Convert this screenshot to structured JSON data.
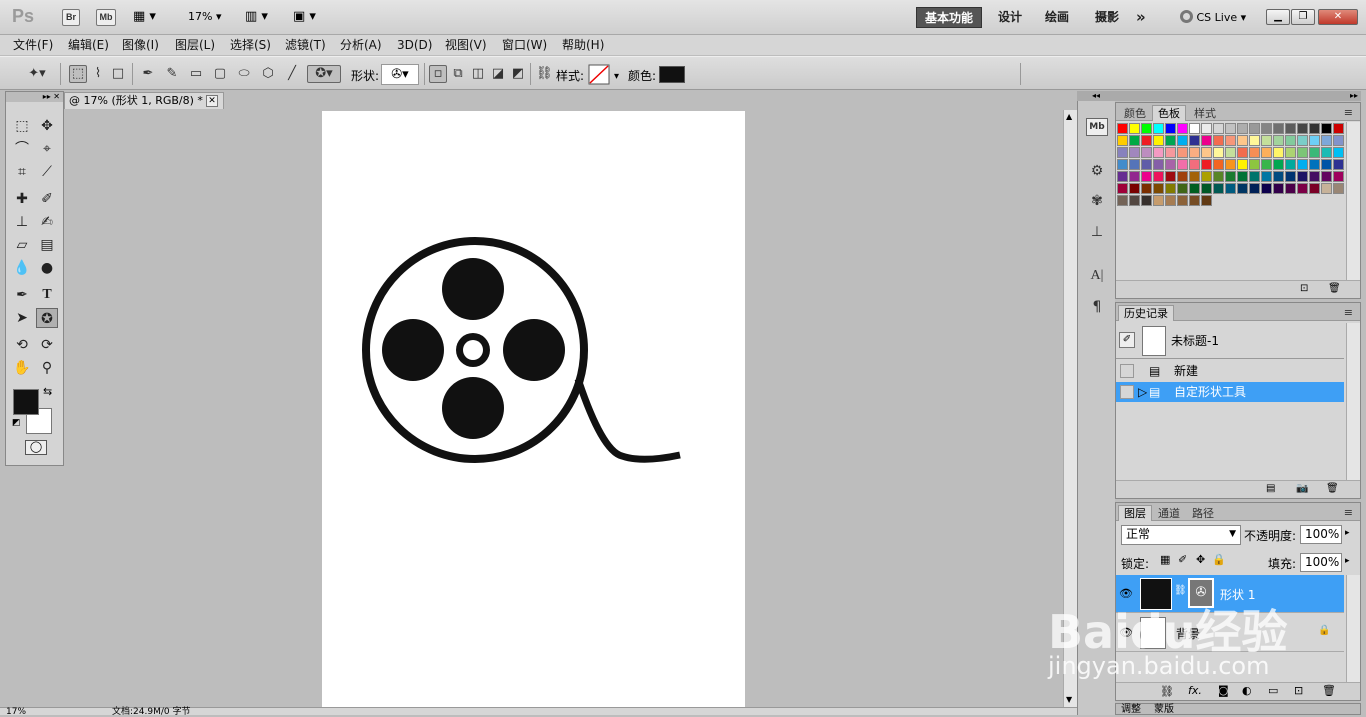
{
  "app": {
    "logo": "Ps",
    "bridge_btn": "Br",
    "minibridge_btn": "Mb",
    "zoom": "17%",
    "workspaces": [
      "基本功能",
      "设计",
      "绘画",
      "摄影"
    ],
    "more": "»",
    "cslive": "CS Live"
  },
  "menu": [
    "文件(F)",
    "编辑(E)",
    "图像(I)",
    "图层(L)",
    "选择(S)",
    "滤镜(T)",
    "分析(A)",
    "3D(D)",
    "视图(V)",
    "窗口(W)",
    "帮助(H)"
  ],
  "options": {
    "shape_label": "形状:",
    "style_label": "样式:",
    "color_label": "颜色:",
    "color": "#111111"
  },
  "document": {
    "tab_title": "@ 17% (形状 1, RGB/8) *",
    "status": "文档:24.9M/0 字节",
    "zoom": "17%"
  },
  "panels": {
    "swatches": {
      "tabs": [
        "颜色",
        "色板",
        "样式"
      ],
      "active": 1,
      "colors": [
        "#ff0000",
        "#ffff00",
        "#00ff00",
        "#00ffff",
        "#0000ff",
        "#ff00ff",
        "#ffffff",
        "#ebebeb",
        "#d6d6d6",
        "#c2c2c2",
        "#adadad",
        "#999999",
        "#858585",
        "#707070",
        "#5c5c5c",
        "#474747",
        "#333333",
        "#000000",
        "#cc0000",
        "#ffcc00",
        "#00aa44",
        "#ee1c24",
        "#fff200",
        "#00a651",
        "#00aeef",
        "#2e3192",
        "#ec008c",
        "#f26c4f",
        "#f69679",
        "#fdc68a",
        "#fff799",
        "#c4df9b",
        "#a2d39c",
        "#82ca9c",
        "#7bcdc8",
        "#6dcff6",
        "#7da7d9",
        "#8393ca",
        "#8781bd",
        "#a187be",
        "#bc8dbf",
        "#f49ac2",
        "#f6989d",
        "#f7977a",
        "#f9ad81",
        "#fdc68a",
        "#fff79a",
        "#c4df9b",
        "#f26c4f",
        "#f68e55",
        "#fbaf5c",
        "#fff467",
        "#acd372",
        "#7cc576",
        "#3bb878",
        "#1abbb4",
        "#00bff3",
        "#438ccb",
        "#5574b9",
        "#605ca8",
        "#855fa8",
        "#a763a8",
        "#f06ea9",
        "#f26d7d",
        "#ed1c24",
        "#f26522",
        "#f7941d",
        "#fff200",
        "#8dc63f",
        "#39b54a",
        "#00a651",
        "#00a99d",
        "#00aeef",
        "#0072bc",
        "#0054a6",
        "#2e3192",
        "#662d91",
        "#92278f",
        "#ec008c",
        "#ed145b",
        "#9e0b0f",
        "#a0410d",
        "#a36209",
        "#aba000",
        "#598527",
        "#1a7b30",
        "#007236",
        "#00746b",
        "#0076a3",
        "#004b80",
        "#003471",
        "#1b1464",
        "#440e62",
        "#630460",
        "#9e005d",
        "#9e0039",
        "#790000",
        "#7b2e00",
        "#7d4900",
        "#827b00",
        "#406618",
        "#005e20",
        "#005826",
        "#005952",
        "#005b7f",
        "#003663",
        "#002157",
        "#0d004c",
        "#32004b",
        "#4b0049",
        "#7b0046",
        "#7a0026",
        "#c7b299",
        "#998675",
        "#736357",
        "#534741",
        "#37302d",
        "#c69c6d",
        "#a67c52",
        "#8c6239",
        "#754c24",
        "#603913"
      ]
    },
    "history": {
      "title": "历史记录",
      "snapshot": "未标题-1",
      "items": [
        "新建",
        "自定形状工具"
      ]
    },
    "layers": {
      "tabs": [
        "图层",
        "通道",
        "路径"
      ],
      "blend_mode": "正常",
      "opacity_label": "不透明度:",
      "opacity": "100%",
      "lock_label": "锁定:",
      "fill_label": "填充:",
      "fill": "100%",
      "rows": [
        {
          "name": "形状 1",
          "selected": true
        },
        {
          "name": "背景",
          "selected": false
        }
      ]
    },
    "adjust": {
      "tabs": [
        "调整",
        "蒙版"
      ]
    }
  },
  "watermark": {
    "brand": "Baidu经验",
    "url": "jingyan.baidu.com"
  }
}
